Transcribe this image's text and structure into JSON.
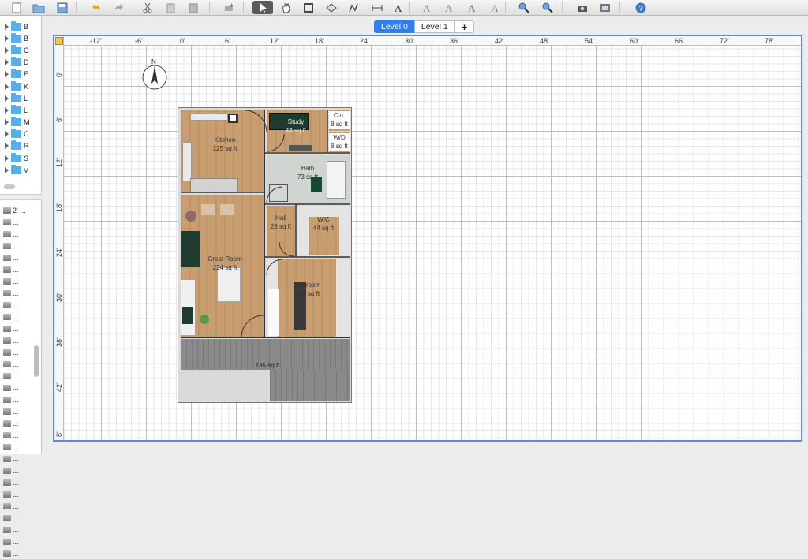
{
  "toolbar": {
    "buttons": [
      "new-home-icon",
      "open-icon",
      "save-icon",
      "undo-icon",
      "redo-icon",
      "cut-icon",
      "copy-icon",
      "paste-icon",
      "add-furniture-icon",
      "select-arrow-icon",
      "pan-hand-icon",
      "create-walls-icon",
      "create-rooms-icon",
      "create-polylines-icon",
      "create-dimensions-icon",
      "add-text-icon",
      "increase-text-icon",
      "decrease-text-icon",
      "bold-text-icon",
      "italic-text-icon",
      "zoom-in-icon",
      "zoom-out-icon",
      "create-photo-icon",
      "create-video-icon",
      "help-icon"
    ]
  },
  "catalog": {
    "categories": [
      "B",
      "B",
      "C",
      "D",
      "E",
      "K",
      "L",
      "L",
      "M",
      "C",
      "R",
      "S",
      "V"
    ],
    "furniture": [
      "2' ...",
      "...",
      "...",
      "...",
      "...",
      "...",
      "...",
      "...",
      "...",
      "...",
      "...",
      "...",
      "...",
      "...",
      "...",
      "...",
      "...",
      "...",
      "...",
      "...",
      "...",
      "...",
      "...",
      "...",
      "...",
      "...",
      "...",
      "...",
      "...",
      "..."
    ]
  },
  "levels": {
    "tabs": [
      "Level 0",
      "Level 1"
    ],
    "add_label": "+"
  },
  "ruler": {
    "top": [
      "-12'",
      "-6'",
      "0'",
      "6'",
      "12'",
      "18'",
      "24'",
      "30'",
      "36'",
      "42'",
      "48'",
      "54'",
      "60'",
      "66'",
      "72'",
      "78'"
    ],
    "left": [
      "0'",
      "6'",
      "12'",
      "18'",
      "24'",
      "30'",
      "36'",
      "42'",
      "8'"
    ]
  },
  "compass": {
    "north": "N"
  },
  "rooms": [
    {
      "name": "Kitchen",
      "area": "125 sq ft"
    },
    {
      "name": "Study",
      "area": "46 sq ft"
    },
    {
      "name": "Clo.",
      "area": "8 sq ft"
    },
    {
      "name": "W/D",
      "area": "8 sq ft"
    },
    {
      "name": "Bath",
      "area": "73 sq ft"
    },
    {
      "name": "Hall",
      "area": "26 sq ft"
    },
    {
      "name": "WIC",
      "area": "44 sq ft"
    },
    {
      "name": "Great Room",
      "area": "224 sq ft"
    },
    {
      "name": "Bedroom",
      "area": "116 sq ft"
    },
    {
      "name": "",
      "area": "135 sq ft"
    }
  ],
  "colors": {
    "accent": "#2f7ff0",
    "plan_border": "#5d87e6",
    "floor": "#c89d6f",
    "porch": "#8a8a8a"
  }
}
